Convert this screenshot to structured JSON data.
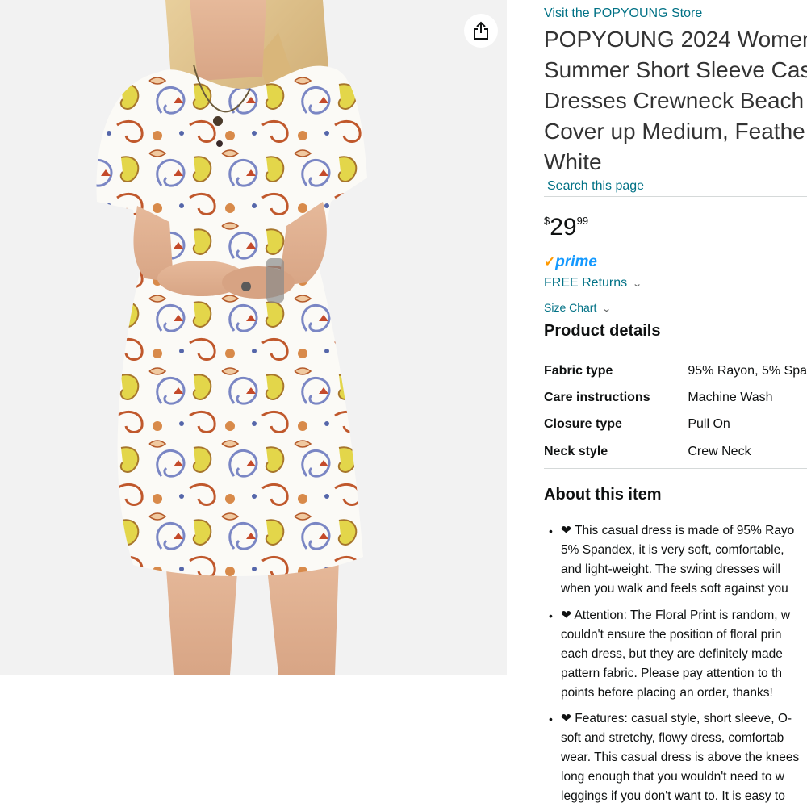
{
  "image": {
    "share_icon": "share-icon"
  },
  "store_link": "Visit the POPYOUNG Store",
  "title_lines": [
    "POPYOUNG 2024 Women",
    "Summer Short Sleeve Cas",
    "Dresses Crewneck Beach",
    "Cover up Medium, Feathe",
    "White"
  ],
  "search_link": "Search this page",
  "price": {
    "symbol": "$",
    "whole": "29",
    "fraction": "99"
  },
  "prime": {
    "check": "✓",
    "label": "prime"
  },
  "returns": {
    "label": "FREE Returns",
    "chevron": "chevron-down-icon"
  },
  "size_chart": {
    "label": "Size Chart",
    "chevron": "chevron-down-icon"
  },
  "product_details": {
    "heading": "Product details",
    "rows": [
      {
        "key": "Fabric type",
        "value": "95% Rayon, 5% Spa"
      },
      {
        "key": "Care instructions",
        "value": "Machine Wash"
      },
      {
        "key": "Closure type",
        "value": "Pull On"
      },
      {
        "key": "Neck style",
        "value": "Crew Neck"
      }
    ]
  },
  "about": {
    "heading": "About this item",
    "bullets": [
      [
        "❤ This casual dress is made of 95% Rayo",
        "5% Spandex, it is very soft, comfortable,",
        "and light-weight. The swing dresses will",
        "when you walk and feels soft against you"
      ],
      [
        "❤ Attention: The Floral Print is random, w",
        "couldn't ensure the position of floral prin",
        "each dress, but they are definitely made",
        "pattern fabric. Please pay attention to th",
        "points before placing an order, thanks!"
      ],
      [
        "❤ Features: casual style, short sleeve, O-",
        "soft and stretchy, flowy dress, comfortab",
        "wear. This casual dress is above the knees",
        "long enough that you wouldn't need to w",
        "leggings if you don't want to. It is easy to"
      ]
    ]
  },
  "colors": {
    "link": "#007185",
    "prime_blue": "#1399FF",
    "prime_check": "#FF9900",
    "image_bg": "#f2f2f2"
  }
}
